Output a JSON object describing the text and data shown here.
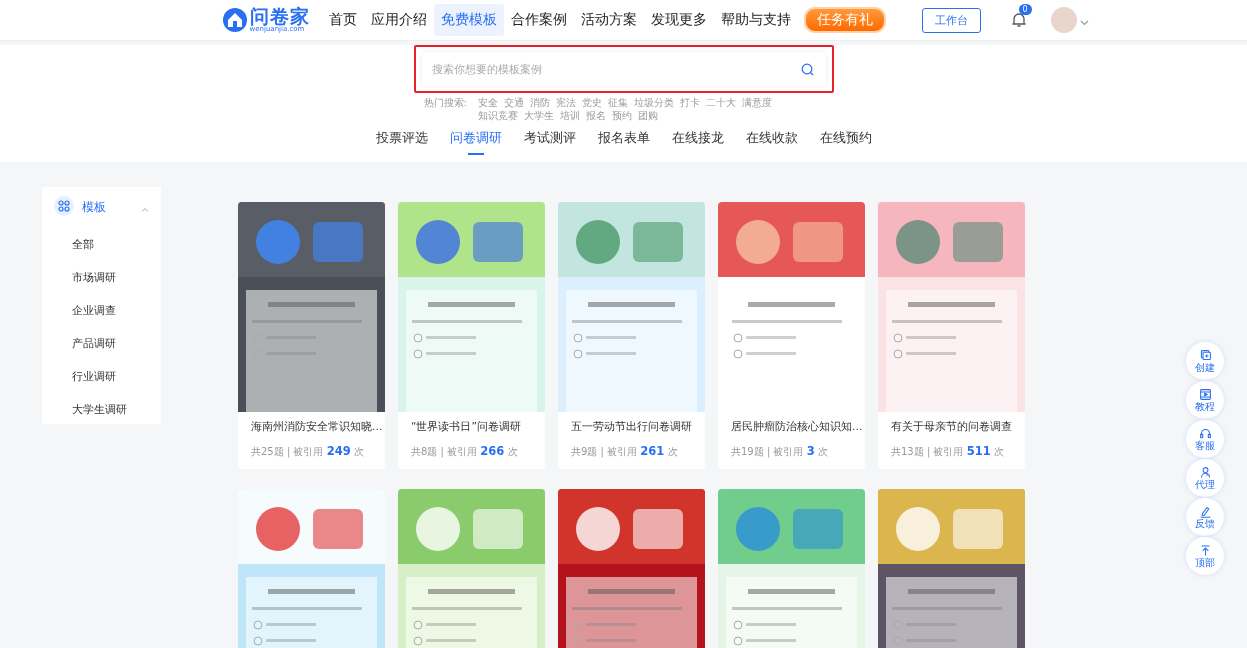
{
  "header": {
    "logo": {
      "name": "问卷家",
      "domain": "wenjuanjia.com"
    },
    "nav": [
      {
        "label": "首页",
        "selected": false
      },
      {
        "label": "应用介绍",
        "selected": false
      },
      {
        "label": "免费模板",
        "selected": true
      },
      {
        "label": "合作案例",
        "selected": false
      },
      {
        "label": "活动方案",
        "selected": false
      },
      {
        "label": "发现更多",
        "selected": false
      },
      {
        "label": "帮助与支持",
        "selected": false
      }
    ],
    "promo": "任务有礼",
    "workbench": "工作台",
    "notification_count": "0"
  },
  "search": {
    "placeholder": "搜索你想要的模板案例",
    "hot_label": "热门搜索:",
    "hot_terms": [
      "安全",
      "交通",
      "消防",
      "宪法",
      "党史",
      "征集",
      "垃圾分类",
      "打卡",
      "二十大",
      "满意度",
      "知识竞赛",
      "大学生",
      "培训",
      "报名",
      "预约",
      "团购"
    ]
  },
  "category_tabs": [
    {
      "label": "投票评选",
      "selected": false
    },
    {
      "label": "问卷调研",
      "selected": true
    },
    {
      "label": "考试测评",
      "selected": false
    },
    {
      "label": "报名表单",
      "selected": false
    },
    {
      "label": "在线接龙",
      "selected": false
    },
    {
      "label": "在线收款",
      "selected": false
    },
    {
      "label": "在线预约",
      "selected": false
    }
  ],
  "sidebar": {
    "title": "模板",
    "expanded": true,
    "items": [
      "全部",
      "市场调研",
      "企业调查",
      "产品调研",
      "行业调研",
      "大学生调研"
    ]
  },
  "cards": [
    {
      "kind": "full",
      "title": "海南州消防安全常识知晓…",
      "questions": "共25题",
      "separator": "|",
      "cited_label": "被引用",
      "cited": "249",
      "unit": "次"
    },
    {
      "kind": "full",
      "title": "“世界读书日”问卷调研",
      "questions": "共8题",
      "separator": "|",
      "cited_label": "被引用",
      "cited": "266",
      "unit": "次"
    },
    {
      "kind": "full",
      "title": "五一劳动节出行问卷调研",
      "questions": "共9题",
      "separator": "|",
      "cited_label": "被引用",
      "cited": "261",
      "unit": "次"
    },
    {
      "kind": "full",
      "title": "居民肿瘤防治核心知识知…",
      "questions": "共19题",
      "separator": "|",
      "cited_label": "被引用",
      "cited": "3",
      "unit": "次"
    },
    {
      "kind": "full",
      "title": "有关于母亲节的问卷调查",
      "questions": "共13题",
      "separator": "|",
      "cited_label": "被引用",
      "cited": "511",
      "unit": "次"
    },
    {
      "kind": "preview_only"
    },
    {
      "kind": "preview_only"
    },
    {
      "kind": "preview_only"
    },
    {
      "kind": "preview_only"
    },
    {
      "kind": "preview_only"
    }
  ],
  "float_tools": [
    {
      "kind": "create",
      "label": "创建"
    },
    {
      "kind": "tutorial",
      "label": "教程"
    },
    {
      "kind": "support",
      "label": "客服"
    },
    {
      "kind": "agent",
      "label": "代理"
    },
    {
      "kind": "feedback",
      "label": "反馈"
    },
    {
      "kind": "top",
      "label": "顶部"
    }
  ]
}
